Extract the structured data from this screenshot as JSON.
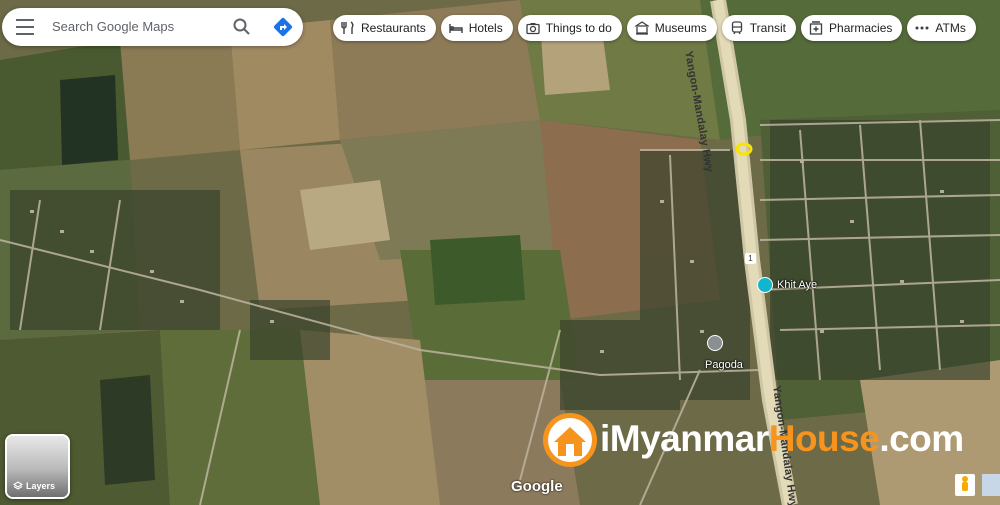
{
  "search": {
    "placeholder": "Search Google Maps"
  },
  "chips": [
    {
      "label": "Restaurants",
      "icon": "fork-knife-icon"
    },
    {
      "label": "Hotels",
      "icon": "bed-icon"
    },
    {
      "label": "Things to do",
      "icon": "camera-icon"
    },
    {
      "label": "Museums",
      "icon": "museum-icon"
    },
    {
      "label": "Transit",
      "icon": "train-icon"
    },
    {
      "label": "Pharmacies",
      "icon": "pharmacy-icon"
    },
    {
      "label": "ATMs",
      "icon": "atm-icon"
    }
  ],
  "map": {
    "road_name": "Yangon-Mandalay Hwy",
    "road_name_lower": "Yangon-Mandalay Hwy",
    "places": [
      {
        "label": "Khit Aye",
        "icon": "shopping-bag-icon"
      },
      {
        "label": "Pagoda",
        "icon": "pagoda-icon"
      }
    ],
    "highway_shield": "1"
  },
  "layers": {
    "label": "Layers"
  },
  "attribution": {
    "google": "Google"
  },
  "watermark": {
    "prefix": "i",
    "name_a": "Myanmar",
    "name_b": "House",
    "suffix": ".com"
  }
}
